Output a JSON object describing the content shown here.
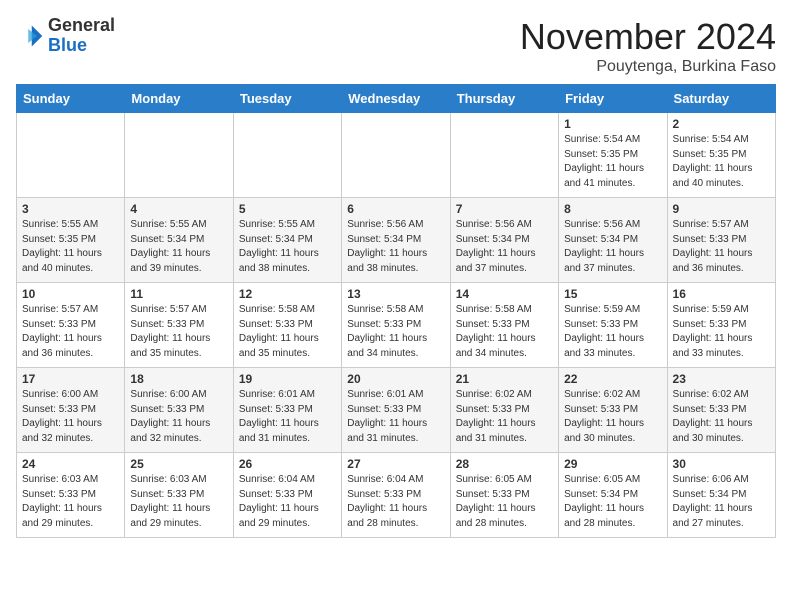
{
  "header": {
    "logo_line1": "General",
    "logo_line2": "Blue",
    "month": "November 2024",
    "location": "Pouytenga, Burkina Faso"
  },
  "weekdays": [
    "Sunday",
    "Monday",
    "Tuesday",
    "Wednesday",
    "Thursday",
    "Friday",
    "Saturday"
  ],
  "weeks": [
    [
      {
        "day": "",
        "info": ""
      },
      {
        "day": "",
        "info": ""
      },
      {
        "day": "",
        "info": ""
      },
      {
        "day": "",
        "info": ""
      },
      {
        "day": "",
        "info": ""
      },
      {
        "day": "1",
        "info": "Sunrise: 5:54 AM\nSunset: 5:35 PM\nDaylight: 11 hours\nand 41 minutes."
      },
      {
        "day": "2",
        "info": "Sunrise: 5:54 AM\nSunset: 5:35 PM\nDaylight: 11 hours\nand 40 minutes."
      }
    ],
    [
      {
        "day": "3",
        "info": "Sunrise: 5:55 AM\nSunset: 5:35 PM\nDaylight: 11 hours\nand 40 minutes."
      },
      {
        "day": "4",
        "info": "Sunrise: 5:55 AM\nSunset: 5:34 PM\nDaylight: 11 hours\nand 39 minutes."
      },
      {
        "day": "5",
        "info": "Sunrise: 5:55 AM\nSunset: 5:34 PM\nDaylight: 11 hours\nand 38 minutes."
      },
      {
        "day": "6",
        "info": "Sunrise: 5:56 AM\nSunset: 5:34 PM\nDaylight: 11 hours\nand 38 minutes."
      },
      {
        "day": "7",
        "info": "Sunrise: 5:56 AM\nSunset: 5:34 PM\nDaylight: 11 hours\nand 37 minutes."
      },
      {
        "day": "8",
        "info": "Sunrise: 5:56 AM\nSunset: 5:34 PM\nDaylight: 11 hours\nand 37 minutes."
      },
      {
        "day": "9",
        "info": "Sunrise: 5:57 AM\nSunset: 5:33 PM\nDaylight: 11 hours\nand 36 minutes."
      }
    ],
    [
      {
        "day": "10",
        "info": "Sunrise: 5:57 AM\nSunset: 5:33 PM\nDaylight: 11 hours\nand 36 minutes."
      },
      {
        "day": "11",
        "info": "Sunrise: 5:57 AM\nSunset: 5:33 PM\nDaylight: 11 hours\nand 35 minutes."
      },
      {
        "day": "12",
        "info": "Sunrise: 5:58 AM\nSunset: 5:33 PM\nDaylight: 11 hours\nand 35 minutes."
      },
      {
        "day": "13",
        "info": "Sunrise: 5:58 AM\nSunset: 5:33 PM\nDaylight: 11 hours\nand 34 minutes."
      },
      {
        "day": "14",
        "info": "Sunrise: 5:58 AM\nSunset: 5:33 PM\nDaylight: 11 hours\nand 34 minutes."
      },
      {
        "day": "15",
        "info": "Sunrise: 5:59 AM\nSunset: 5:33 PM\nDaylight: 11 hours\nand 33 minutes."
      },
      {
        "day": "16",
        "info": "Sunrise: 5:59 AM\nSunset: 5:33 PM\nDaylight: 11 hours\nand 33 minutes."
      }
    ],
    [
      {
        "day": "17",
        "info": "Sunrise: 6:00 AM\nSunset: 5:33 PM\nDaylight: 11 hours\nand 32 minutes."
      },
      {
        "day": "18",
        "info": "Sunrise: 6:00 AM\nSunset: 5:33 PM\nDaylight: 11 hours\nand 32 minutes."
      },
      {
        "day": "19",
        "info": "Sunrise: 6:01 AM\nSunset: 5:33 PM\nDaylight: 11 hours\nand 31 minutes."
      },
      {
        "day": "20",
        "info": "Sunrise: 6:01 AM\nSunset: 5:33 PM\nDaylight: 11 hours\nand 31 minutes."
      },
      {
        "day": "21",
        "info": "Sunrise: 6:02 AM\nSunset: 5:33 PM\nDaylight: 11 hours\nand 31 minutes."
      },
      {
        "day": "22",
        "info": "Sunrise: 6:02 AM\nSunset: 5:33 PM\nDaylight: 11 hours\nand 30 minutes."
      },
      {
        "day": "23",
        "info": "Sunrise: 6:02 AM\nSunset: 5:33 PM\nDaylight: 11 hours\nand 30 minutes."
      }
    ],
    [
      {
        "day": "24",
        "info": "Sunrise: 6:03 AM\nSunset: 5:33 PM\nDaylight: 11 hours\nand 29 minutes."
      },
      {
        "day": "25",
        "info": "Sunrise: 6:03 AM\nSunset: 5:33 PM\nDaylight: 11 hours\nand 29 minutes."
      },
      {
        "day": "26",
        "info": "Sunrise: 6:04 AM\nSunset: 5:33 PM\nDaylight: 11 hours\nand 29 minutes."
      },
      {
        "day": "27",
        "info": "Sunrise: 6:04 AM\nSunset: 5:33 PM\nDaylight: 11 hours\nand 28 minutes."
      },
      {
        "day": "28",
        "info": "Sunrise: 6:05 AM\nSunset: 5:33 PM\nDaylight: 11 hours\nand 28 minutes."
      },
      {
        "day": "29",
        "info": "Sunrise: 6:05 AM\nSunset: 5:34 PM\nDaylight: 11 hours\nand 28 minutes."
      },
      {
        "day": "30",
        "info": "Sunrise: 6:06 AM\nSunset: 5:34 PM\nDaylight: 11 hours\nand 27 minutes."
      }
    ]
  ]
}
